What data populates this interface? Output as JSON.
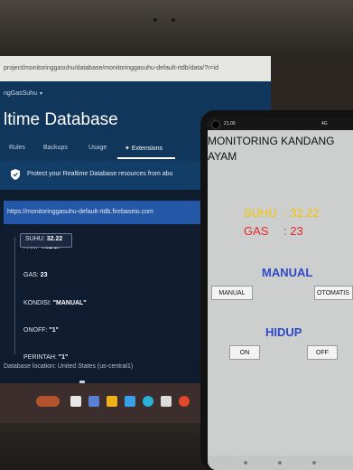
{
  "colors": {
    "suhu_accent": "#f5c400",
    "gas_accent": "#e52a2a",
    "section_title": "#2f48c9",
    "firebase_header": "#10365c"
  },
  "browser": {
    "url": "project/monitoringgasuhu/database/monitoringgasuhu-default-rtdb/data/?r=id"
  },
  "firebase": {
    "project_name": "ngGasSuhu",
    "title": "ltime Database",
    "tabs": [
      "Rules",
      "Backups",
      "Usage",
      "Extensions"
    ],
    "protect_banner": "Protect your Realtime Database resources from abu",
    "db_url": "https://monitoringgasuhu-default-rtdb.firebaseio.com",
    "fields": [
      {
        "key": "FAN",
        "value": "\"HIDUP\""
      },
      {
        "key": "GAS",
        "value": "23"
      },
      {
        "key": "KONDISI",
        "value": "\"MANUAL\""
      },
      {
        "key": "ONOFF",
        "value": "\"1\""
      },
      {
        "key": "PERINTAH",
        "value": "\"1\""
      },
      {
        "key": "SUHU",
        "value": "32.22"
      }
    ],
    "location": "Database location: United States (us-central1)"
  },
  "phone": {
    "status_time": "21.00",
    "status_right": "4G",
    "app_title": "MONITORING KANDANG AYAM",
    "suhu_label": "SUHU",
    "suhu_value": ": 32.22",
    "gas_label": "GAS",
    "gas_value": ": 23",
    "mode_title": "MANUAL",
    "manual_button": "MANUAL",
    "otomatis_button": "OTOMATIS",
    "status_title": "HIDUP",
    "on_button": "ON",
    "off_button": "OFF"
  }
}
